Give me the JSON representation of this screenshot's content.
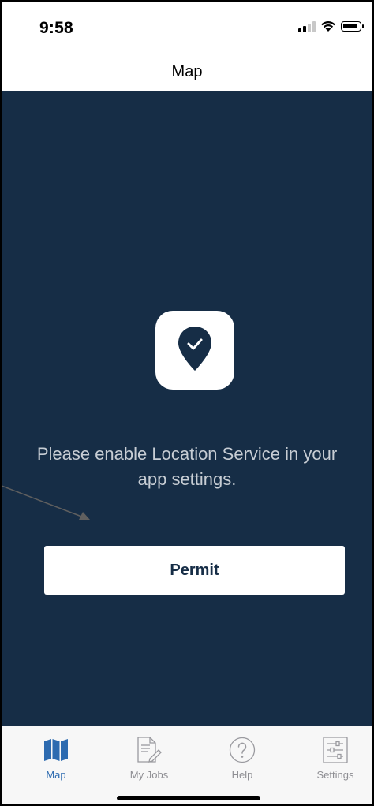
{
  "status_bar": {
    "time": "9:58",
    "icons": [
      "signal-icon",
      "wifi-icon",
      "battery-icon"
    ]
  },
  "nav": {
    "title": "Map"
  },
  "main": {
    "app_icon": "location-check-icon",
    "message": "Please enable Location Service in your app settings.",
    "permit_button": "Permit"
  },
  "tabs": [
    {
      "label": "Map",
      "icon": "map-icon",
      "active": true
    },
    {
      "label": "My Jobs",
      "icon": "jobs-icon",
      "active": false
    },
    {
      "label": "Help",
      "icon": "help-icon",
      "active": false
    },
    {
      "label": "Settings",
      "icon": "settings-icon",
      "active": false
    }
  ],
  "colors": {
    "panel_background": "#162d46",
    "active_tab": "#2d6bb0",
    "inactive_tab": "#8e8e93",
    "message_text": "#c7cdd4"
  }
}
